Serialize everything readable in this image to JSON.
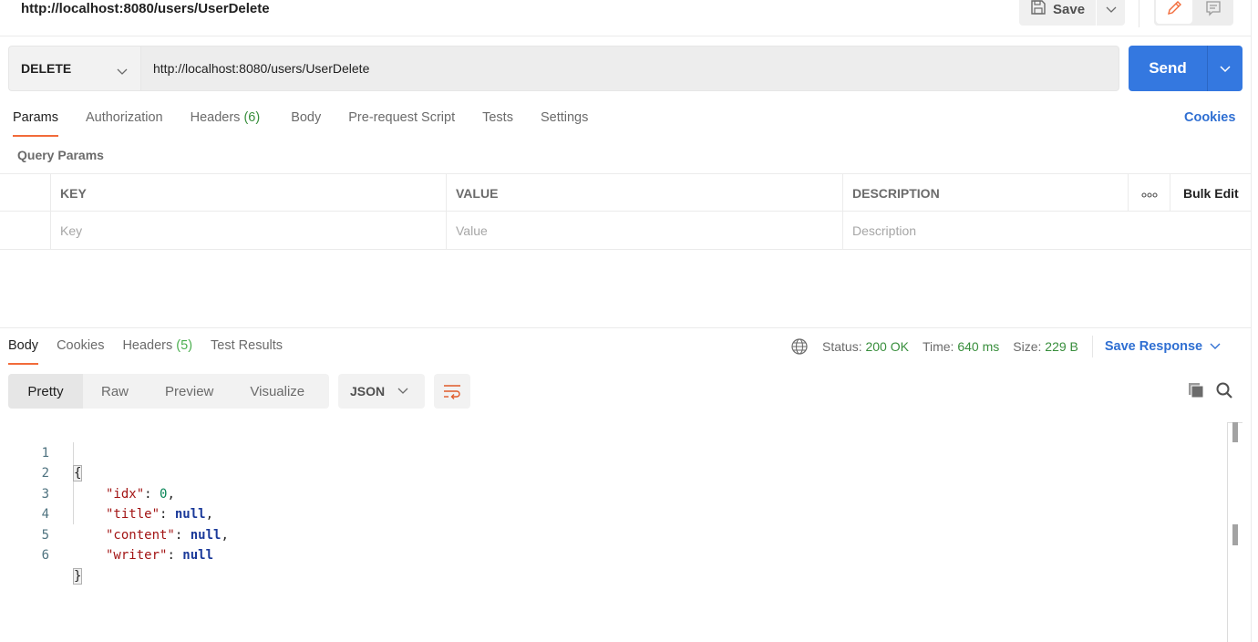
{
  "header": {
    "title": "http://localhost:8080/users/UserDelete",
    "save_label": "Save",
    "icons": {
      "save": "floppy-disk-icon",
      "save_dropdown": "chevron-down-icon",
      "edit_mode": "pencil-icon",
      "comment_mode": "comment-icon"
    }
  },
  "request": {
    "method": "DELETE",
    "url": "http://localhost:8080/users/UserDelete",
    "send_label": "Send"
  },
  "request_tabs": [
    {
      "label": "Params",
      "active": true
    },
    {
      "label": "Authorization"
    },
    {
      "label": "Headers",
      "count": "(6)"
    },
    {
      "label": "Body"
    },
    {
      "label": "Pre-request Script"
    },
    {
      "label": "Tests"
    },
    {
      "label": "Settings"
    }
  ],
  "cookies_link": "Cookies",
  "query_params": {
    "label": "Query Params",
    "columns": {
      "key": "KEY",
      "value": "VALUE",
      "description": "DESCRIPTION",
      "more": "ooo",
      "bulk_edit": "Bulk Edit"
    },
    "placeholders": {
      "key": "Key",
      "value": "Value",
      "description": "Description"
    }
  },
  "response": {
    "tabs": [
      {
        "label": "Body",
        "active": true
      },
      {
        "label": "Cookies"
      },
      {
        "label": "Headers",
        "count": "(5)"
      },
      {
        "label": "Test Results"
      }
    ],
    "status_label": "Status:",
    "status_value": "200 OK",
    "time_label": "Time:",
    "time_value": "640 ms",
    "size_label": "Size:",
    "size_value": "229 B",
    "save_response": "Save Response",
    "format_tabs": [
      "Pretty",
      "Raw",
      "Preview",
      "Visualize"
    ],
    "language": "JSON",
    "accent_colors": {
      "status_green": "#388e3c",
      "link_blue": "#2f6fd2",
      "send_blue": "#3478e0",
      "tab_underline": "#f26b3a"
    },
    "body_lines": [
      {
        "num": "1",
        "open": "{"
      },
      {
        "num": "2",
        "key": "\"idx\"",
        "value": "0",
        "type": "number",
        "comma": ","
      },
      {
        "num": "3",
        "key": "\"title\"",
        "value": "null",
        "type": "null",
        "comma": ","
      },
      {
        "num": "4",
        "key": "\"content\"",
        "value": "null",
        "type": "null",
        "comma": ","
      },
      {
        "num": "5",
        "key": "\"writer\"",
        "value": "null",
        "type": "null",
        "comma": ""
      },
      {
        "num": "6",
        "close": "}"
      }
    ]
  }
}
